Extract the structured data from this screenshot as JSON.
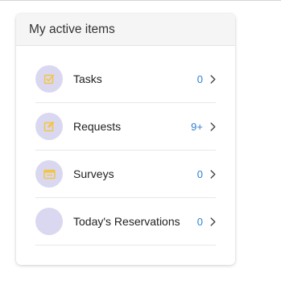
{
  "widget": {
    "title": "My active items",
    "items": [
      {
        "label": "Tasks",
        "count": "0",
        "icon": "checkbox-icon"
      },
      {
        "label": "Requests",
        "count": "9+",
        "icon": "edit-icon"
      },
      {
        "label": "Surveys",
        "count": "0",
        "icon": "survey-icon"
      },
      {
        "label": "Today's Reservations",
        "count": "0",
        "icon": ""
      }
    ]
  },
  "colors": {
    "icon_yellow": "#f4c542",
    "avatar_bg": "#d9d8f0",
    "count_blue": "#2f7fd1"
  }
}
